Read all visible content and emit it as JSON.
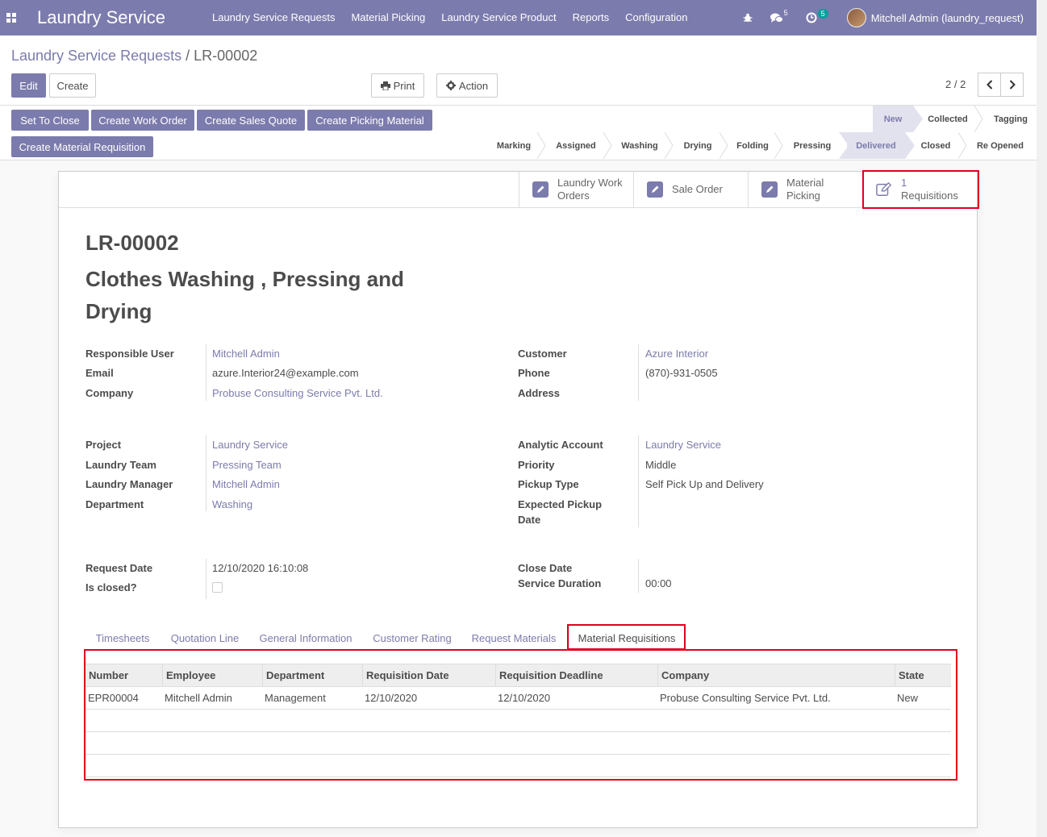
{
  "navbar": {
    "apps_icon": "apps-grid-icon",
    "brand": "Laundry Service",
    "menu": [
      "Laundry Service Requests",
      "Material Picking",
      "Laundry Service Product",
      "Reports",
      "Configuration"
    ],
    "messages_count": "5",
    "activities_count": "5",
    "user": "Mitchell Admin (laundry_request)"
  },
  "breadcrumb": {
    "parent": "Laundry Service Requests",
    "separator": "/",
    "current": "LR-00002"
  },
  "toolbar": {
    "edit": "Edit",
    "create": "Create",
    "print": "Print",
    "action": "Action"
  },
  "pager": {
    "value": "2 / 2"
  },
  "header_buttons": {
    "set_to_close": "Set To Close",
    "create_work_order": "Create Work Order",
    "create_sales_quote": "Create Sales Quote",
    "create_picking_material": "Create Picking Material",
    "create_material_requisition": "Create Material Requisition"
  },
  "stages": {
    "row1": [
      "New",
      "Collected",
      "Tagging"
    ],
    "row2": [
      "Marking",
      "Assigned",
      "Washing",
      "Drying",
      "Folding",
      "Pressing",
      "Delivered",
      "Closed",
      "Re Opened"
    ],
    "current": "Delivered"
  },
  "smart_buttons": {
    "work_orders_l1": "Laundry Work",
    "work_orders_l2": "Orders",
    "sale_order": "Sale Order",
    "material_picking_l1": "Material",
    "material_picking_l2": "Picking",
    "requisitions_count": "1",
    "requisitions_label": "Requisitions"
  },
  "record": {
    "reference": "LR-00002",
    "name": "Clothes Washing , Pressing and Drying"
  },
  "fields": {
    "responsible_user": {
      "label": "Responsible User",
      "value": "Mitchell Admin"
    },
    "email": {
      "label": "Email",
      "value": "azure.Interior24@example.com"
    },
    "company": {
      "label": "Company",
      "value": "Probuse Consulting Service Pvt. Ltd."
    },
    "customer": {
      "label": "Customer",
      "value": "Azure Interior"
    },
    "phone": {
      "label": "Phone",
      "value": "(870)-931-0505"
    },
    "address": {
      "label": "Address",
      "value": ""
    },
    "project": {
      "label": "Project",
      "value": "Laundry Service"
    },
    "laundry_team": {
      "label": "Laundry Team",
      "value": "Pressing Team"
    },
    "laundry_manager": {
      "label": "Laundry Manager",
      "value": "Mitchell Admin"
    },
    "department": {
      "label": "Department",
      "value": "Washing"
    },
    "analytic_account": {
      "label": "Analytic Account",
      "value": "Laundry Service"
    },
    "priority": {
      "label": "Priority",
      "value": "Middle"
    },
    "pickup_type": {
      "label": "Pickup Type",
      "value": "Self Pick Up and Delivery"
    },
    "expected_pickup_l1": {
      "label": "Expected Pickup"
    },
    "expected_pickup_l2": {
      "label": "Date"
    },
    "request_date": {
      "label": "Request Date",
      "value": "12/10/2020 16:10:08"
    },
    "is_closed": {
      "label": "Is closed?",
      "checked": false
    },
    "close_date": {
      "label": "Close Date",
      "value": ""
    },
    "service_duration": {
      "label": "Service Duration",
      "value": "00:00"
    }
  },
  "tabs": [
    "Timesheets",
    "Quotation Line",
    "General Information",
    "Customer Rating",
    "Request Materials",
    "Material Requisitions"
  ],
  "active_tab": "Material Requisitions",
  "requisitions_table": {
    "columns": [
      "Number",
      "Employee",
      "Department",
      "Requisition Date",
      "Requisition Deadline",
      "Company",
      "State"
    ],
    "rows": [
      [
        "EPR00004",
        "Mitchell Admin",
        "Management",
        "12/10/2020",
        "12/10/2020",
        "Probuse Consulting Service Pvt. Ltd.",
        "New"
      ]
    ]
  },
  "colors": {
    "primary": "#7c7bad",
    "highlight": "#e00020",
    "badge": "#00a09d"
  }
}
